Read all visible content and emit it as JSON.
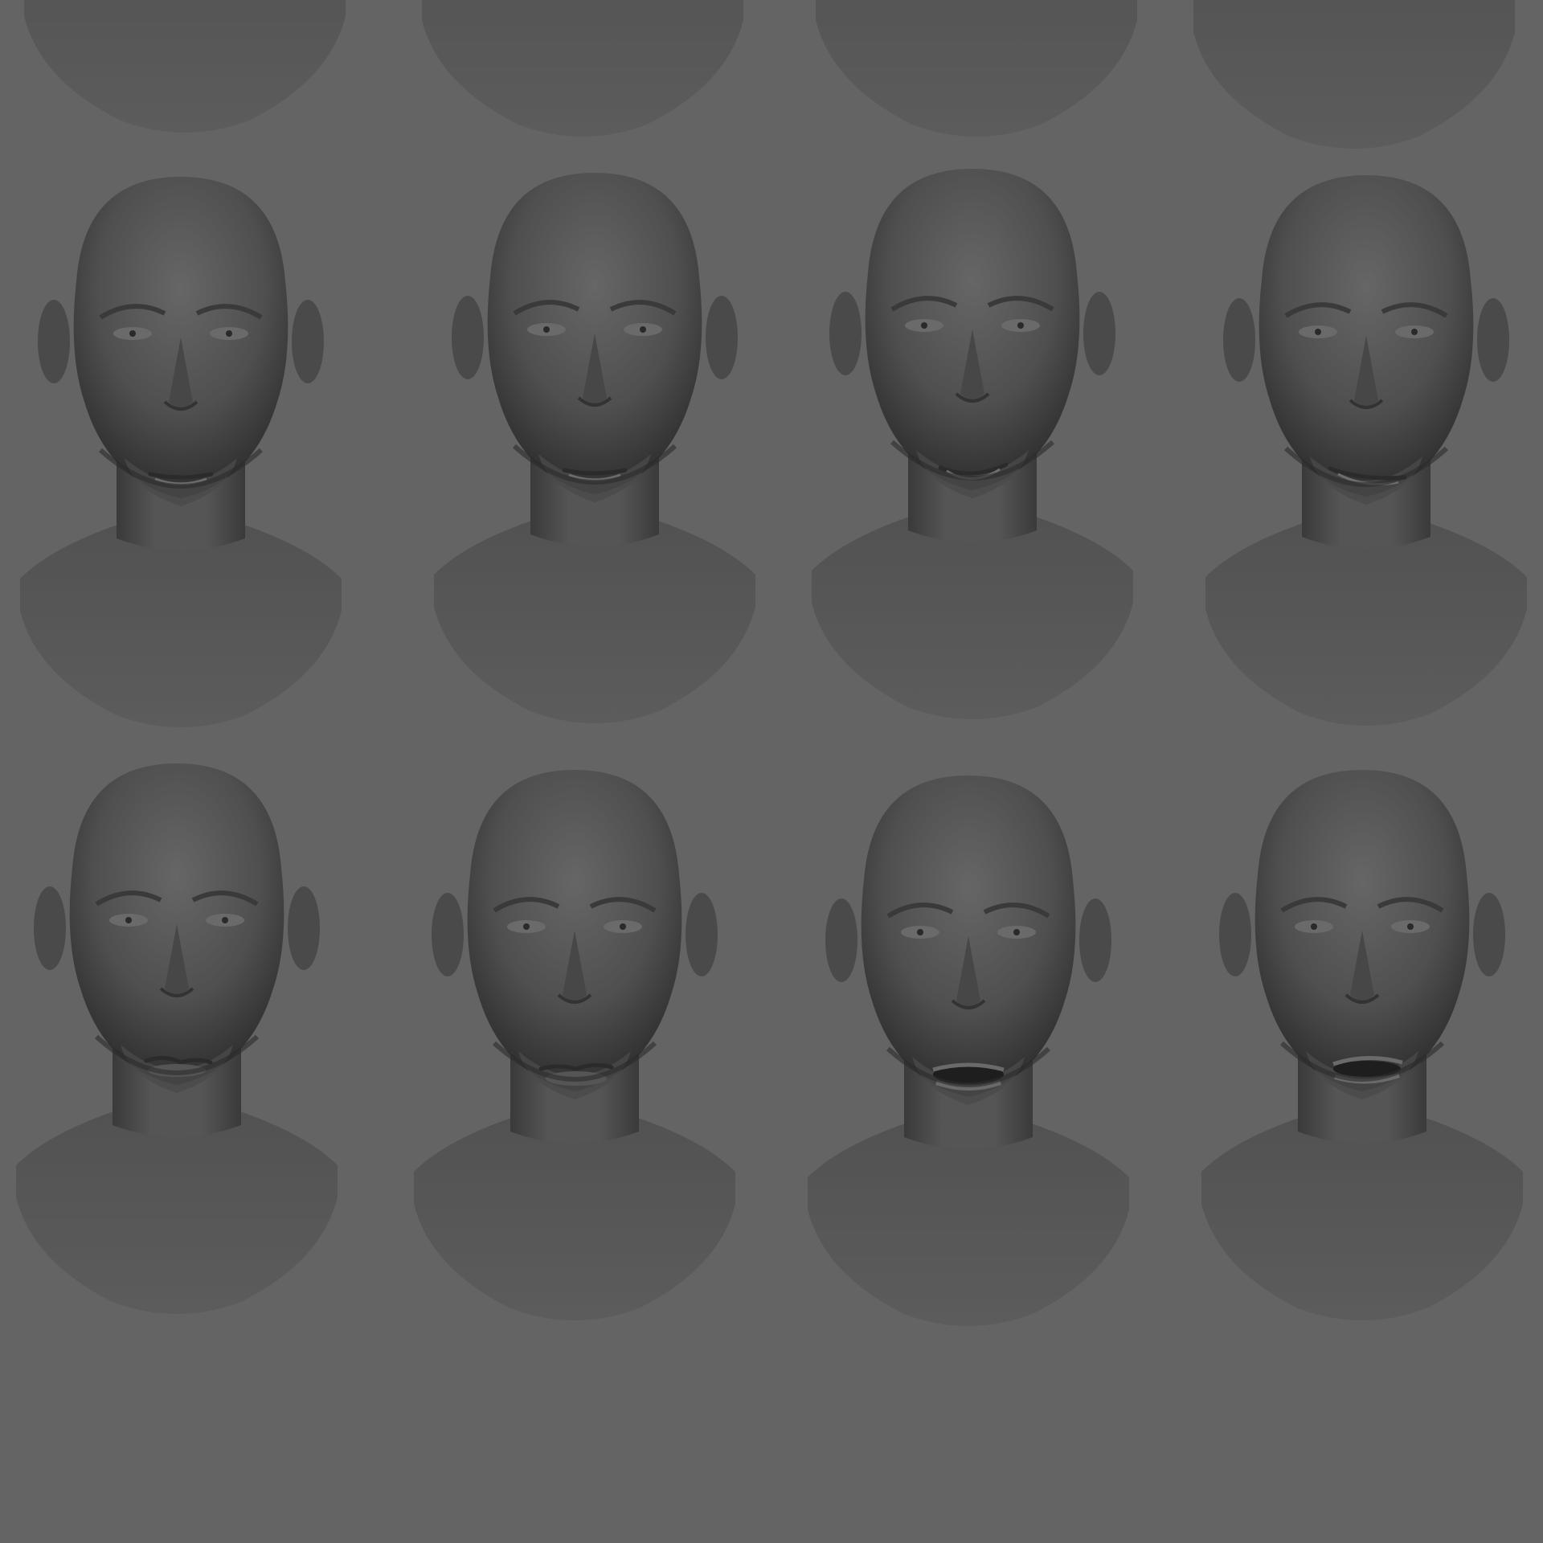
{
  "background_color": "#646464",
  "skin_tone": "#5a5a5a",
  "grid": {
    "rows": 3,
    "columns": 4,
    "top_row_cropped": true
  },
  "busts": [
    {
      "row": 1,
      "col": 1,
      "expression": "neutral",
      "cropped": true
    },
    {
      "row": 1,
      "col": 2,
      "expression": "neutral",
      "cropped": true
    },
    {
      "row": 1,
      "col": 3,
      "expression": "neutral",
      "cropped": true
    },
    {
      "row": 1,
      "col": 4,
      "expression": "neutral",
      "cropped": true
    },
    {
      "row": 2,
      "col": 1,
      "expression": "neutral-closed-mouth"
    },
    {
      "row": 2,
      "col": 2,
      "expression": "neutral-closed-mouth"
    },
    {
      "row": 2,
      "col": 3,
      "expression": "slight-smile"
    },
    {
      "row": 2,
      "col": 4,
      "expression": "asymmetric-smile"
    },
    {
      "row": 3,
      "col": 1,
      "expression": "lip-bite-left"
    },
    {
      "row": 3,
      "col": 2,
      "expression": "lip-bite-right"
    },
    {
      "row": 3,
      "col": 3,
      "expression": "open-mouth"
    },
    {
      "row": 3,
      "col": 4,
      "expression": "open-mouth-side"
    }
  ]
}
